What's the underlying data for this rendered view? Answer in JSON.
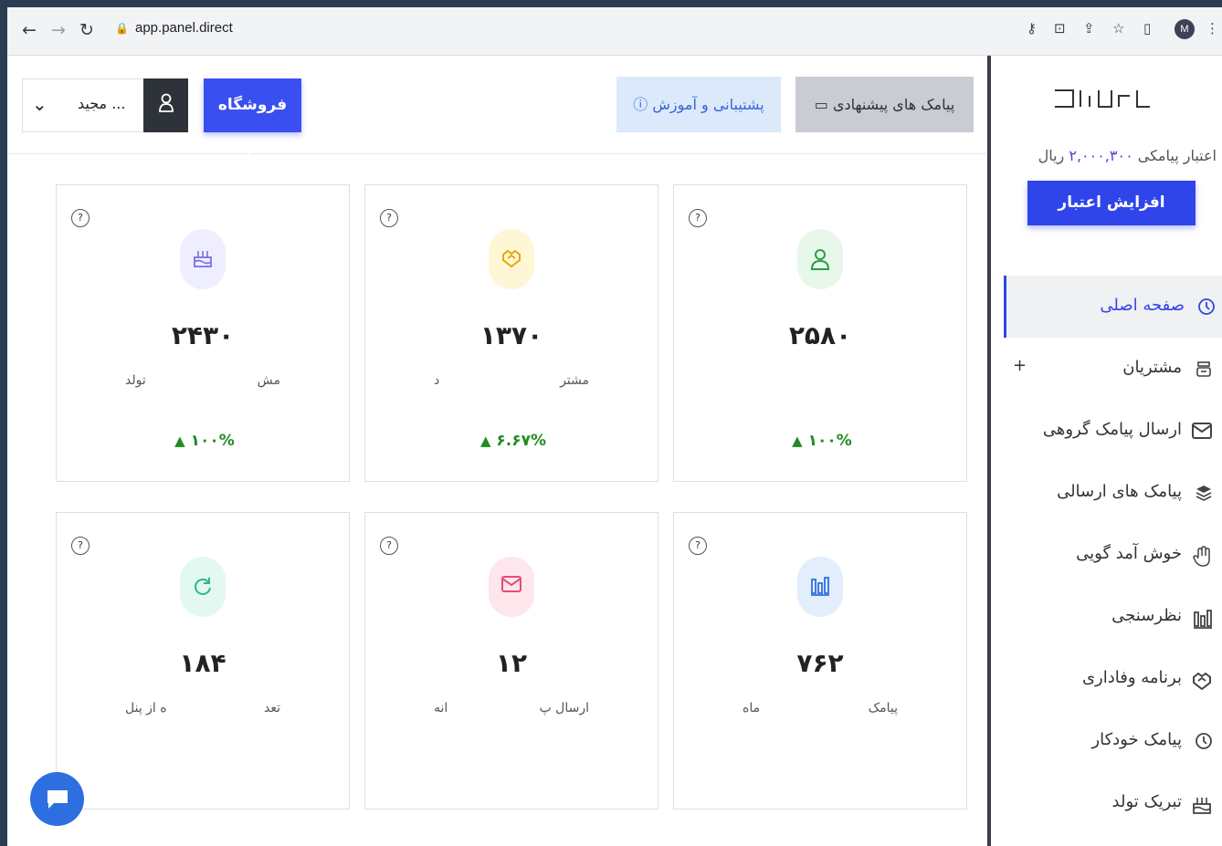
{
  "browser": {
    "url": "app.panel.direct",
    "profile_initial": "M",
    "icons": [
      "back-icon",
      "forward-icon",
      "reload-icon",
      "lock-icon",
      "key-icon",
      "install-icon",
      "share-icon",
      "star-icon",
      "sidebar-toggle-icon",
      "menu-icon"
    ]
  },
  "header": {
    "store_button": "فروشگاه ساز",
    "user_name": "مجید ...",
    "support_button": "پشتیبانی و آموزش",
    "suggested_button": "پیامک های پیشنهادی"
  },
  "sidebar": {
    "logo": "دایرکت",
    "credit_prefix": "اعتبار پیامکی",
    "credit_amount": "۲,۰۰۰,۳۰۰",
    "credit_suffix": "ریال",
    "increase_credit_button": "افزایش اعتبار",
    "items": [
      {
        "label": "صفحه اصلی",
        "icon": "clock-icon",
        "active": true
      },
      {
        "label": "مشتریان",
        "icon": "customers-icon",
        "plus": "+"
      },
      {
        "label": "ارسال پیامک گروهی",
        "icon": "envelope-icon"
      },
      {
        "label": "پیامک های ارسالی",
        "icon": "layers-icon"
      },
      {
        "label": "خوش آمد گویی",
        "icon": "waving-hand-icon"
      },
      {
        "label": "نظرسنجی",
        "icon": "poll-icon"
      },
      {
        "label": "برنامه وفاداری",
        "icon": "handshake-icon"
      },
      {
        "label": "پیامک خودکار",
        "icon": "auto-clock-icon"
      },
      {
        "label": "تبریک تولد",
        "icon": "cake-icon"
      }
    ]
  },
  "cards": [
    {
      "value": "۲۵۸۰",
      "desc_right": "",
      "desc_left": "",
      "change": "۱۰۰%",
      "icon": "customer-icon",
      "color": "#e7f7ea",
      "icon_color": "#2e9e44"
    },
    {
      "value": "۱۳۷۰",
      "desc_right": "مشتر",
      "desc_left": "د",
      "change": "۶.۶۷%",
      "icon": "handshake-icon",
      "color": "#fff6d6",
      "icon_color": "#e6a700"
    },
    {
      "value": "۲۴۳۰",
      "desc_right": "مش",
      "desc_left": "تولد",
      "change": "۱۰۰%",
      "icon": "cake-icon",
      "color": "#efeefe",
      "icon_color": "#7a6fe6"
    },
    {
      "value": "۷۶۲",
      "desc_right": "پیامک",
      "desc_left": "ماه",
      "change": "",
      "icon": "poll-icon",
      "color": "#e2eefc",
      "icon_color": "#2d6fe0"
    },
    {
      "value": "۱۲",
      "desc_right": "ارسال پ",
      "desc_left": "انه",
      "change": "",
      "icon": "envelope-icon",
      "color": "#fde6ec",
      "icon_color": "#e84a78"
    },
    {
      "value": "۱۸۴",
      "desc_right": "تعد",
      "desc_left": "ه از پنل",
      "change": "",
      "icon": "refresh-icon",
      "color": "#e3f8f1",
      "icon_color": "#2bb88a"
    }
  ]
}
